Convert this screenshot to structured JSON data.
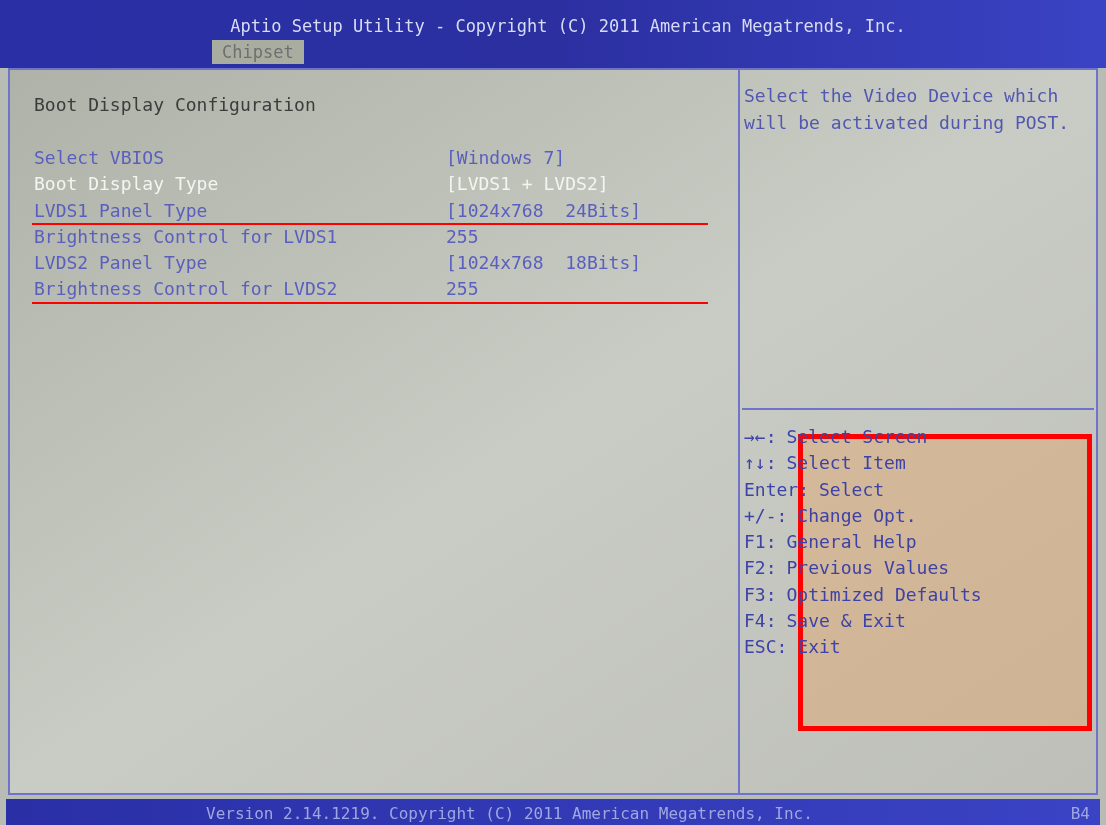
{
  "header": {
    "title": "Aptio Setup Utility - Copyright (C) 2011 American Megatrends, Inc.",
    "tabs": [
      {
        "label": "Chipset",
        "selected": true
      }
    ]
  },
  "section_title": "Boot Display Configuration",
  "items": [
    {
      "label": "Select VBIOS",
      "value": "[Windows 7]",
      "selected": false,
      "marked": false
    },
    {
      "label": "Boot Display Type",
      "value": "[LVDS1 + LVDS2]",
      "selected": true,
      "marked": false
    },
    {
      "label": "LVDS1 Panel Type",
      "value": "[1024x768  24Bits]",
      "selected": false,
      "marked": true
    },
    {
      "label": "Brightness Control for LVDS1",
      "value": "255",
      "selected": false,
      "marked": false
    },
    {
      "label": "LVDS2 Panel Type",
      "value": "[1024x768  18Bits]",
      "selected": false,
      "marked": false
    },
    {
      "label": "Brightness Control for LVDS2",
      "value": "255",
      "selected": false,
      "marked": true
    }
  ],
  "help_text": "Select the Video Device which will be activated during POST.",
  "keys": [
    {
      "key": "→←:",
      "action": "Select Screen"
    },
    {
      "key": "↑↓:",
      "action": "Select Item"
    },
    {
      "key": "Enter:",
      "action": "Select"
    },
    {
      "key": "+/-:",
      "action": "Change Opt."
    },
    {
      "key": "F1:",
      "action": "General Help"
    },
    {
      "key": "F2:",
      "action": "Previous Values"
    },
    {
      "key": "F3:",
      "action": "Optimized Defaults"
    },
    {
      "key": "F4:",
      "action": "Save & Exit"
    },
    {
      "key": "ESC:",
      "action": "Exit"
    }
  ],
  "keys_highlighted": true,
  "footer": {
    "version": "Version 2.14.1219. Copyright (C) 2011 American Megatrends, Inc.",
    "code": "B4"
  }
}
